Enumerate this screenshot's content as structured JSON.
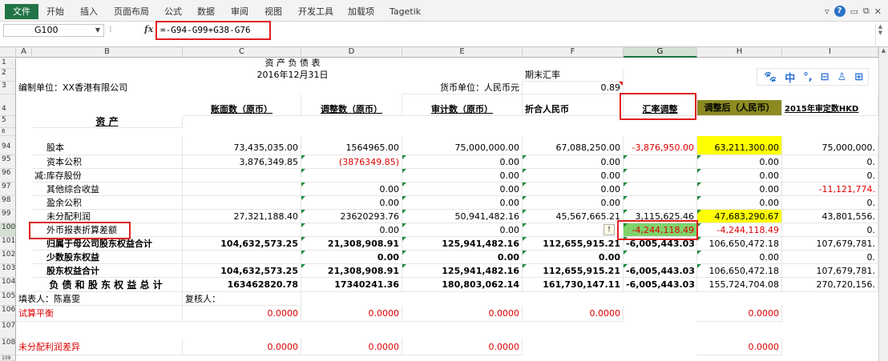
{
  "ribbon": {
    "tabs": [
      "文件",
      "开始",
      "插入",
      "页面布局",
      "公式",
      "数据",
      "审阅",
      "视图",
      "开发工具",
      "加载项",
      "Tagetik"
    ]
  },
  "formula_bar": {
    "name_box": "G100",
    "fx": "fx",
    "formula": "=-G94-G99+G38-G76"
  },
  "columns": [
    "A",
    "B",
    "C",
    "D",
    "E",
    "F",
    "G",
    "H",
    "I"
  ],
  "sheet": {
    "title": "资 产 负 债 表",
    "date": "2016年12月31日",
    "period_end_rate_label": "期末汇率",
    "rate_value": "0.89",
    "unit_label": "编制单位：XX香港有限公司",
    "currency_label": "货币单位：人民币元",
    "headers": {
      "c": "账面数（原币）",
      "d": "调整数（原币）",
      "e": "审计数（原币）",
      "f": "折合人民币",
      "g": "汇率调整",
      "h": "调整后（人民币）",
      "i": "2015年审定数HKD"
    },
    "section_assets": "资 产",
    "rows": [
      {
        "num": "94",
        "b": "股本",
        "c": "73,435,035.00",
        "d": "1564965.00",
        "e": "75,000,000.00",
        "f": "67,088,250.00",
        "g": "-3,876,950.00",
        "h": "63,211,300.00",
        "i": "75,000,000."
      },
      {
        "num": "95",
        "b": "资本公积",
        "c": "3,876,349.85",
        "d": "(3876349.85)",
        "e": "0.00",
        "f": "0.00",
        "g": "",
        "h": "0.00",
        "i": "0."
      },
      {
        "num": "96",
        "b": "减:库存股份",
        "c": "",
        "d": "",
        "e": "0.00",
        "f": "0.00",
        "g": "",
        "h": "0.00",
        "i": "0."
      },
      {
        "num": "97",
        "b": "其他综合收益",
        "c": "",
        "d": "0.00",
        "e": "0.00",
        "f": "0.00",
        "g": "",
        "h": "0.00",
        "i": "-11,121,774."
      },
      {
        "num": "98",
        "b": "盈余公积",
        "c": "",
        "d": "0.00",
        "e": "0.00",
        "f": "0.00",
        "g": "",
        "h": "0.00",
        "i": "0."
      },
      {
        "num": "99",
        "b": "未分配利润",
        "c": "27,321,188.40",
        "d": "23620293.76",
        "e": "50,941,482.16",
        "f": "45,567,665.21",
        "g": "3,115,625.46",
        "h": "47,683,290.67",
        "i": "43,801,556."
      },
      {
        "num": "100",
        "b": "外币报表折算差额",
        "c": "",
        "d": "0.00",
        "e": "0.00",
        "f": "",
        "g": "-4,244,118.49",
        "h": "-4,244,118.49",
        "i": "0."
      },
      {
        "num": "101",
        "b": "归属于母公司股东权益合计",
        "c": "104,632,573.25",
        "d": "21,308,908.91",
        "e": "125,941,482.16",
        "f": "112,655,915.21",
        "g": "-6,005,443.03",
        "h": "106,650,472.18",
        "i": "107,679,781."
      },
      {
        "num": "102",
        "b": "少数股东权益",
        "c": "",
        "d": "0.00",
        "e": "0.00",
        "f": "0.00",
        "g": "",
        "h": "0.00",
        "i": "0."
      },
      {
        "num": "103",
        "b": "股东权益合计",
        "c": "104,632,573.25",
        "d": "21,308,908.91",
        "e": "125,941,482.16",
        "f": "112,655,915.21",
        "g": "-6,005,443.03",
        "h": "106,650,472.18",
        "i": "107,679,781."
      },
      {
        "num": "104",
        "b": "负 债 和 股 东 权 益 总 计",
        "c": "163462820.78",
        "d": "17340241.36",
        "e": "180,803,062.14",
        "f": "161,730,147.11",
        "g": "-6,005,443.03",
        "h": "155,724,704.08",
        "i": "270,720,156."
      }
    ],
    "preparer": "填表人：陈嘉雯",
    "reviewer": "复核人：",
    "trial_balance_label": "试算平衡",
    "retained_diff_label": "未分配利润差异",
    "check_values": {
      "c": "0.0000",
      "d": "0.0000",
      "e": "0.0000",
      "f": "0.0000",
      "h": "0.0000"
    },
    "row_numbers": [
      "1",
      "2",
      "3",
      "4",
      "5",
      "6",
      "94",
      "95",
      "96",
      "97",
      "98",
      "99",
      "100",
      "101",
      "102",
      "103",
      "104",
      "105",
      "106",
      "107",
      "108",
      "109"
    ]
  },
  "ime_toolbar": {
    "glyphs": [
      "中",
      "°,",
      "⊟",
      "♙",
      "⊞"
    ]
  },
  "colors": {
    "excel_green": "#217346",
    "highlight_red": "#e01e1e",
    "yellow": "#ffff00",
    "olive": "#8b8b22",
    "cell_green": "#7fd36a"
  }
}
